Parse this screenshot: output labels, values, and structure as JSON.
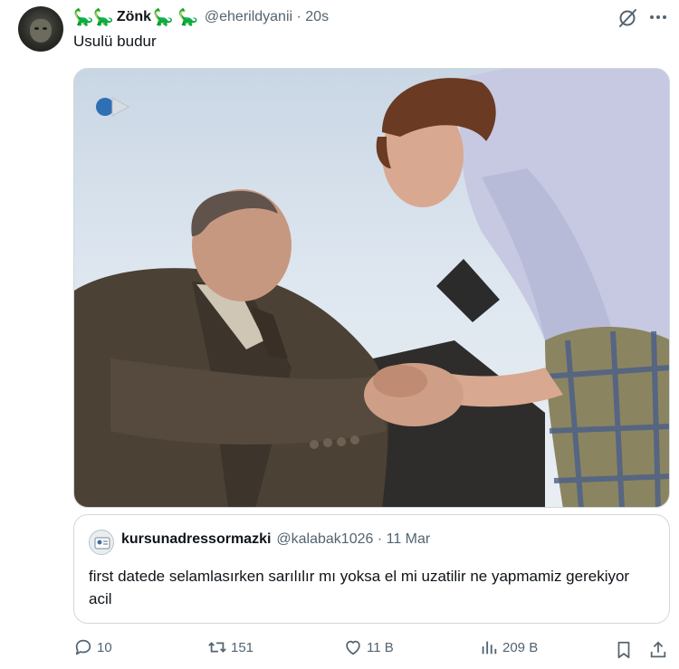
{
  "tweet": {
    "display_name_emoji_left": "🦕🦕",
    "display_name": "Zönk",
    "display_name_emoji_right": "🦕 🦕",
    "handle_time": "@eherildyanii · 20s",
    "text": "Usulü budur"
  },
  "quote": {
    "name": "kursunadressormazki",
    "handle_time": "@kalabak1026 · 11 Mar",
    "text": "first datede selamlasırken sarılılır mı yoksa el mi uzatilir ne yapmamiz gerekiyor acil"
  },
  "actions": {
    "replies": "10",
    "reposts": "151",
    "likes": "11 B",
    "views": "209 B"
  },
  "icons": {
    "grok": "grok-icon",
    "more": "more-icon",
    "reply": "reply-icon",
    "repost": "repost-icon",
    "like": "heart-icon",
    "views": "views-icon",
    "bookmark": "bookmark-icon",
    "share": "share-icon"
  },
  "colors": {
    "text": "#0f1419",
    "secondary": "#536471",
    "border": "#cfd9de",
    "emoji_green": "#3f9a2e"
  }
}
